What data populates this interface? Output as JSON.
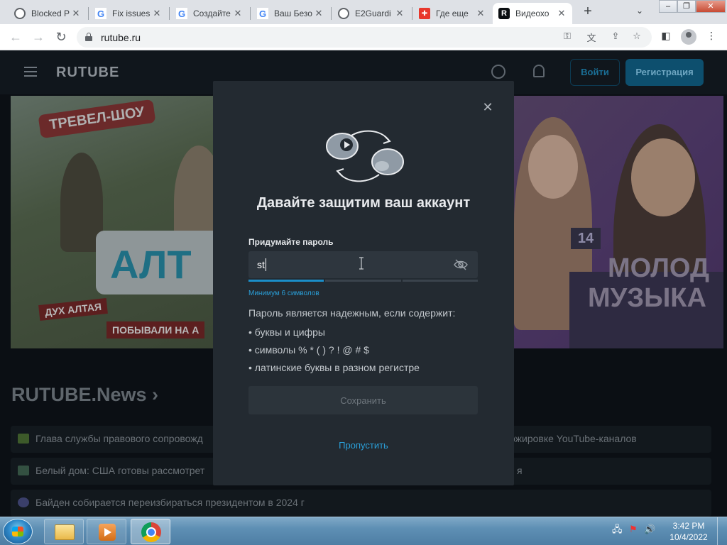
{
  "browser": {
    "tabs": [
      {
        "title": "Blocked P",
        "icon": "globe-icon"
      },
      {
        "title": "Fix issues",
        "icon": "google-icon"
      },
      {
        "title": "Создайте",
        "icon": "google-icon"
      },
      {
        "title": "Ваш Безо",
        "icon": "google-icon"
      },
      {
        "title": "E2Guardi",
        "icon": "globe-icon"
      },
      {
        "title": "Где еще",
        "icon": "red-flag-icon"
      },
      {
        "title": "Видеохо",
        "icon": "rutube-icon"
      }
    ],
    "active_tab": 6,
    "new_tab": "+",
    "url": "rutube.ru",
    "window_controls": [
      "–",
      "❐",
      "✕"
    ]
  },
  "site": {
    "logo": "RUTUBE",
    "login_label": "Войти",
    "register_label": "Регистрация",
    "banner_left": {
      "badge": "ТРЕВЕЛ-ШОУ",
      "title": "АЛТ",
      "subtitle": "ДУХ АЛТАЯ",
      "subtitle2": "ПОБЫВАЛИ НА А"
    },
    "banner_right": {
      "number": "14",
      "title_line1": "МОЛОД",
      "title_line2": "МУЗЫКА"
    },
    "news_heading": "RUTUBE.News ›",
    "news": [
      {
        "text": "Глава службы правового сопровожд",
        "right": "ожировке YouTube-каналов"
      },
      {
        "text": "Белый дом: США готовы рассмотрет",
        "right": "я"
      },
      {
        "text": "Байден собирается переизбираться президентом в 2024 г",
        "right": ""
      }
    ]
  },
  "modal": {
    "title": "Давайте защитим ваш аккаунт",
    "field_label": "Придумайте пароль",
    "password_value": "st",
    "strength_segments_filled": 1,
    "strength_segments_total": 3,
    "min_hint": "Минимум 6 символов",
    "rules_title": "Пароль является надежным, если содержит:",
    "rules": [
      "• буквы и цифры",
      "• символы % * ( ) ? ! @ # $",
      "• латинские буквы в разном регистре"
    ],
    "save_label": "Сохранить",
    "skip_label": "Пропустить",
    "close_icon": "close-icon"
  },
  "taskbar": {
    "apps": [
      "file-explorer-icon",
      "media-player-icon",
      "chrome-icon"
    ],
    "time": "3:42 PM",
    "date": "10/4/2022"
  },
  "colors": {
    "modal_bg": "#232a31",
    "accent": "#2a9fd8",
    "strength_on": "#1b8ec9"
  }
}
